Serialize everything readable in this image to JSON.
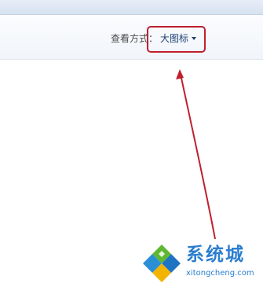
{
  "toolbar": {
    "view_label": "查看方式：",
    "view_value": "大图标"
  },
  "annotation": {
    "box_color": "#c0202e",
    "arrow_color": "#c0202e"
  },
  "watermark": {
    "title": "系统城",
    "subtitle": "xitongcheng.com"
  },
  "icons": {
    "dropdown": "chevron-down-icon",
    "logo": "diamond-logo-icon"
  }
}
